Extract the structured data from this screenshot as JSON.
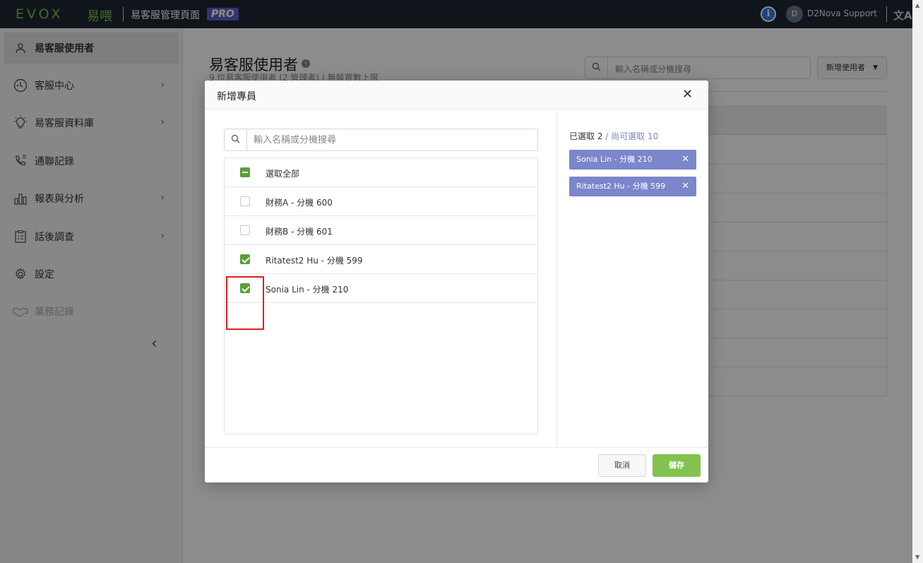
{
  "topbar": {
    "logo": "EVOX",
    "logo_cn": "易喂",
    "title": "易客服管理頁面",
    "badge": "PRO",
    "user_initial": "D",
    "user_name": "D2Nova Support"
  },
  "sidebar": {
    "items": [
      {
        "label": "易客服使用者",
        "icon": "user-icon"
      },
      {
        "label": "客服中心",
        "icon": "service-center-icon"
      },
      {
        "label": "易客服資料庫",
        "icon": "lightbulb-icon"
      },
      {
        "label": "通聯記錄",
        "icon": "phone-log-icon"
      },
      {
        "label": "報表與分析",
        "icon": "bar-chart-icon"
      },
      {
        "label": "話後調查",
        "icon": "survey-icon"
      },
      {
        "label": "設定",
        "icon": "gear-icon"
      },
      {
        "label": "業務記錄",
        "icon": "handshake-icon"
      }
    ]
  },
  "main": {
    "title": "易客服使用者",
    "subtitle": "9 位易客服使用者 (2 管理者) | 無裝置數上限",
    "search_placeholder": "輸入名稱或分機搜尋",
    "add_user_label": "新增使用者"
  },
  "modal": {
    "title": "新增專員",
    "search_placeholder": "輸入名稱或分機搜尋",
    "select_all": "選取全部",
    "list": [
      {
        "label": "財務A - 分機 600",
        "checked": false
      },
      {
        "label": "財務B - 分機 601",
        "checked": false
      },
      {
        "label": "Ritatest2 Hu - 分機 599",
        "checked": true
      },
      {
        "label": "Sonia Lin - 分機 210",
        "checked": true
      }
    ],
    "selected_count": "已選取 2",
    "remaining": " / 尚可選取 10",
    "chips": [
      "Sonia Lin - 分機 210",
      "Ritatest2 Hu - 分機 599"
    ],
    "cancel_label": "取消",
    "save_label": "儲存"
  }
}
